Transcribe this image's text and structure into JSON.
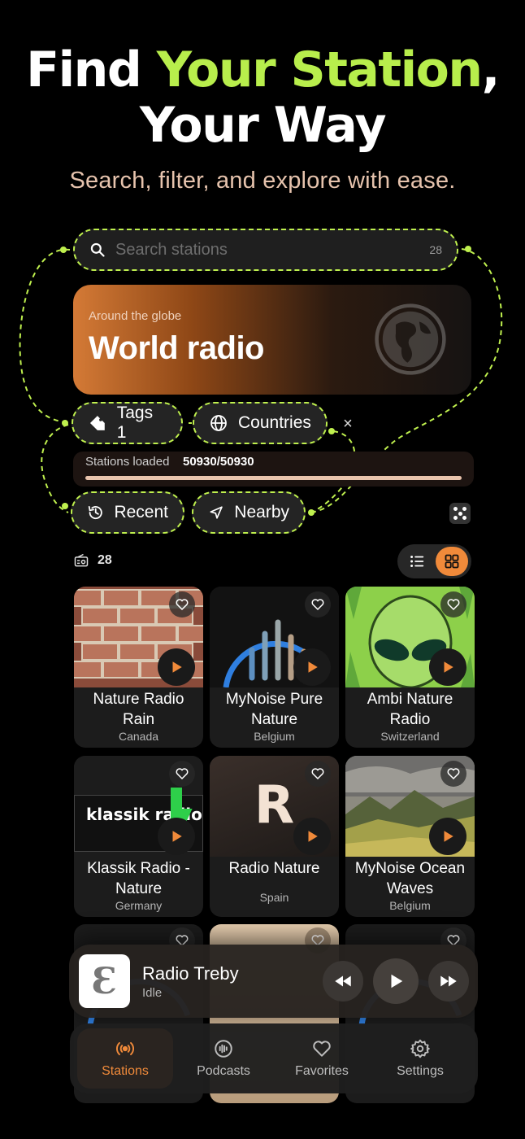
{
  "hero": {
    "title_part1": "Find ",
    "title_accent": "Your Station",
    "title_part2": ",",
    "title_line2": "Your Way",
    "subtitle": "Search, filter, and explore with ease."
  },
  "search": {
    "placeholder": "Search stations",
    "count": "28"
  },
  "world_card": {
    "eyebrow": "Around the globe",
    "title": "World radio",
    "icon": "globe-icon"
  },
  "filters": {
    "tags_label": "Tags 1",
    "countries_label": "Countries",
    "clear_label": "×",
    "recent_label": "Recent",
    "nearby_label": "Nearby"
  },
  "loaded": {
    "label": "Stations loaded",
    "value": "50930/50930",
    "progress": 1.0
  },
  "results": {
    "count": "28",
    "view": "grid"
  },
  "stations": [
    {
      "name": "Nature Radio Rain",
      "country": "Canada"
    },
    {
      "name": "MyNoise Pure Nature",
      "country": "Belgium"
    },
    {
      "name": "Ambi Nature Radio",
      "country": "Switzerland"
    },
    {
      "name": "Klassik Radio - Nature",
      "country": "Germany",
      "art_text": "klassik radio"
    },
    {
      "name": "Radio Nature",
      "country": "Spain",
      "art_text": "R"
    },
    {
      "name": "MyNoise Ocean Waves",
      "country": "Belgium"
    }
  ],
  "player": {
    "title": "Radio Treby",
    "status": "Idle",
    "cover_letter": "Ɛ"
  },
  "tabs": [
    {
      "label": "Stations",
      "icon": "radio-waves-icon",
      "active": true
    },
    {
      "label": "Podcasts",
      "icon": "podcast-icon",
      "active": false
    },
    {
      "label": "Favorites",
      "icon": "heart-icon",
      "active": false
    },
    {
      "label": "Settings",
      "icon": "gear-icon",
      "active": false
    }
  ],
  "colors": {
    "accent_green": "#b8ee4c",
    "accent_orange": "#f08a3a",
    "background": "#000000"
  }
}
